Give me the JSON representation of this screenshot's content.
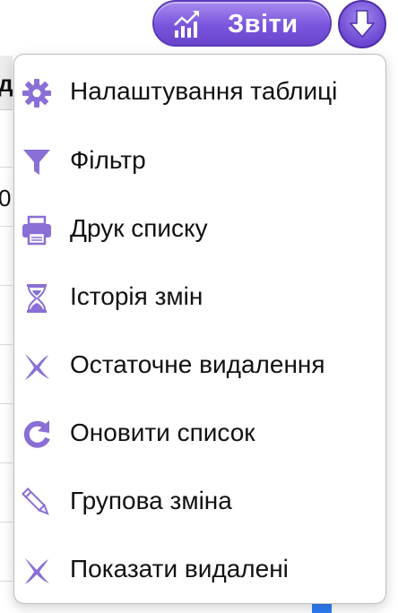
{
  "header": {
    "reports_label": "Звіти",
    "reports_icon": "chart-growth-icon",
    "dropdown_icon": "arrow-down-icon"
  },
  "menu": {
    "items": [
      {
        "label": "Налаштування таблиці",
        "icon": "gear-icon"
      },
      {
        "label": "Фільтр",
        "icon": "funnel-icon"
      },
      {
        "label": "Друк списку",
        "icon": "printer-icon"
      },
      {
        "label": "Історія змін",
        "icon": "hourglass-icon"
      },
      {
        "label": "Остаточне видалення",
        "icon": "cross-icon"
      },
      {
        "label": "Оновити список",
        "icon": "refresh-icon"
      },
      {
        "label": "Групова зміна",
        "icon": "pencil-icon"
      },
      {
        "label": "Показати видалені",
        "icon": "cross-icon"
      }
    ]
  },
  "colors": {
    "accent": "#7a55dd",
    "icon": "#8a6fd6",
    "text": "#111111",
    "checkbox": "#2f7df6"
  }
}
